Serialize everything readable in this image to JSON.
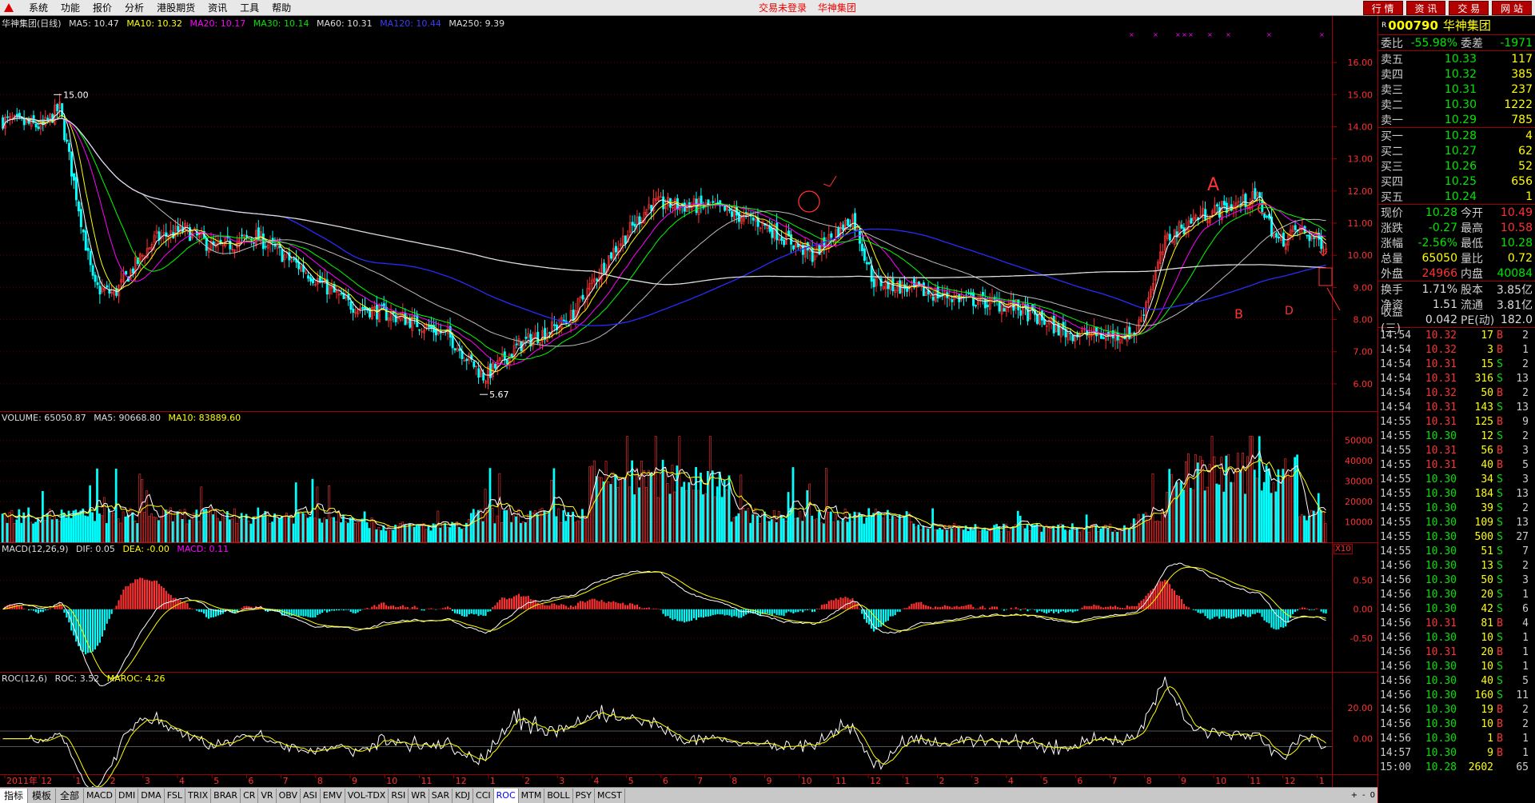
{
  "menubar": {
    "items": [
      "系统",
      "功能",
      "报价",
      "分析",
      "港股期货",
      "资讯",
      "工具",
      "帮助"
    ],
    "status_text": "交易未登录",
    "stock_title": "华神集团",
    "nav_buttons": [
      "行 情",
      "资 讯",
      "交 易",
      "网 站"
    ]
  },
  "main_chart": {
    "title": "华神集团(日线)",
    "ma5": "MA5: 10.47",
    "ma10": "MA10: 10.32",
    "ma20": "MA20: 10.17",
    "ma30": "MA30: 10.14",
    "ma60": "MA60: 10.31",
    "ma120": "MA120: 10.44",
    "ma250": "MA250: 9.39",
    "high_label": "15.00",
    "low_label": "5.67",
    "annotations": [
      "A",
      "C",
      "B",
      "D"
    ]
  },
  "volume_chart": {
    "volume": "VOLUME: 65050.87",
    "ma5": "MA5: 90668.80",
    "ma10": "MA10: 83889.60",
    "unit_badge": "X10"
  },
  "macd_chart": {
    "title": "MACD(12,26,9)",
    "dif": "DIF: 0.05",
    "dea": "DEA: -0.00",
    "macd": "MACD: 0.11"
  },
  "roc_chart": {
    "title": "ROC(12,6)",
    "roc": "ROC: 3.52",
    "maroc": "MAROC: 4.26"
  },
  "x_axis": {
    "labels": [
      "2011年",
      "12",
      "1",
      "2",
      "3",
      "4",
      "5",
      "6",
      "7",
      "8",
      "9",
      "10",
      "11",
      "12",
      "1",
      "2",
      "3",
      "4",
      "5",
      "6",
      "7",
      "8",
      "9",
      "10",
      "11",
      "12",
      "1",
      "2",
      "3",
      "4",
      "5",
      "6",
      "7",
      "8",
      "9",
      "10",
      "11",
      "12",
      "1"
    ],
    "period": "日线"
  },
  "price_axis": [
    "16.00",
    "15.00",
    "14.00",
    "13.00",
    "12.00",
    "11.00",
    "10.00",
    "9.00",
    "8.00",
    "7.00",
    "6.00"
  ],
  "volume_axis": [
    "50000",
    "40000",
    "30000",
    "20000",
    "10000"
  ],
  "macd_axis": [
    "0.50",
    "0.00",
    "-0.50"
  ],
  "roc_axis": [
    "20.00",
    "0.00"
  ],
  "quote": {
    "code": "000790",
    "name": "华神集团",
    "r_badge": "R",
    "weibi_label": "委比",
    "weibi": "-55.98%",
    "weicha_label": "委差",
    "weicha": "-1971",
    "sells": [
      {
        "label": "卖五",
        "price": "10.33",
        "vol": "117"
      },
      {
        "label": "卖四",
        "price": "10.32",
        "vol": "385"
      },
      {
        "label": "卖三",
        "price": "10.31",
        "vol": "237"
      },
      {
        "label": "卖二",
        "price": "10.30",
        "vol": "1222"
      },
      {
        "label": "卖一",
        "price": "10.29",
        "vol": "785"
      }
    ],
    "buys": [
      {
        "label": "买一",
        "price": "10.28",
        "vol": "4"
      },
      {
        "label": "买二",
        "price": "10.27",
        "vol": "62"
      },
      {
        "label": "买三",
        "price": "10.26",
        "vol": "52"
      },
      {
        "label": "买四",
        "price": "10.25",
        "vol": "656"
      },
      {
        "label": "买五",
        "price": "10.24",
        "vol": "1"
      }
    ],
    "stats": [
      {
        "l1": "现价",
        "v1": "10.28",
        "c1": "green",
        "l2": "今开",
        "v2": "10.49",
        "c2": "red"
      },
      {
        "l1": "涨跌",
        "v1": "-0.27",
        "c1": "green",
        "l2": "最高",
        "v2": "10.58",
        "c2": "red"
      },
      {
        "l1": "涨幅",
        "v1": "-2.56%",
        "c1": "green",
        "l2": "最低",
        "v2": "10.28",
        "c2": "green"
      },
      {
        "l1": "总量",
        "v1": "65050",
        "c1": "yellow",
        "l2": "量比",
        "v2": "0.72",
        "c2": "yellow"
      },
      {
        "l1": "外盘",
        "v1": "24966",
        "c1": "red",
        "l2": "内盘",
        "v2": "40084",
        "c2": "green"
      }
    ],
    "fundamentals": [
      {
        "l1": "换手",
        "v1": "1.71%",
        "l2": "股本",
        "v2": "3.85亿"
      },
      {
        "l1": "净资",
        "v1": "1.51",
        "l2": "流通",
        "v2": "3.81亿"
      },
      {
        "l1": "收益(三)",
        "v1": "0.042",
        "l2": "PE(动)",
        "v2": "182.0"
      }
    ],
    "ticks": [
      {
        "t": "14:54",
        "p": "10.32",
        "v": "17",
        "d": "B",
        "n": "2"
      },
      {
        "t": "14:54",
        "p": "10.32",
        "v": "3",
        "d": "B",
        "n": "1"
      },
      {
        "t": "14:54",
        "p": "10.31",
        "v": "15",
        "d": "S",
        "n": "2"
      },
      {
        "t": "14:54",
        "p": "10.31",
        "v": "316",
        "d": "S",
        "n": "13"
      },
      {
        "t": "14:54",
        "p": "10.32",
        "v": "50",
        "d": "B",
        "n": "2"
      },
      {
        "t": "14:54",
        "p": "10.31",
        "v": "143",
        "d": "S",
        "n": "13"
      },
      {
        "t": "14:55",
        "p": "10.31",
        "v": "125",
        "d": "B",
        "n": "9"
      },
      {
        "t": "14:55",
        "p": "10.30",
        "v": "12",
        "d": "S",
        "n": "2"
      },
      {
        "t": "14:55",
        "p": "10.31",
        "v": "56",
        "d": "B",
        "n": "3"
      },
      {
        "t": "14:55",
        "p": "10.31",
        "v": "40",
        "d": "B",
        "n": "5"
      },
      {
        "t": "14:55",
        "p": "10.30",
        "v": "34",
        "d": "S",
        "n": "3"
      },
      {
        "t": "14:55",
        "p": "10.30",
        "v": "184",
        "d": "S",
        "n": "13"
      },
      {
        "t": "14:55",
        "p": "10.30",
        "v": "39",
        "d": "S",
        "n": "2"
      },
      {
        "t": "14:55",
        "p": "10.30",
        "v": "109",
        "d": "S",
        "n": "13"
      },
      {
        "t": "14:55",
        "p": "10.30",
        "v": "500",
        "d": "S",
        "n": "27"
      },
      {
        "t": "14:55",
        "p": "10.30",
        "v": "51",
        "d": "S",
        "n": "7"
      },
      {
        "t": "14:56",
        "p": "10.30",
        "v": "13",
        "d": "S",
        "n": "2"
      },
      {
        "t": "14:56",
        "p": "10.30",
        "v": "50",
        "d": "S",
        "n": "3"
      },
      {
        "t": "14:56",
        "p": "10.30",
        "v": "20",
        "d": "S",
        "n": "1"
      },
      {
        "t": "14:56",
        "p": "10.30",
        "v": "42",
        "d": "S",
        "n": "6"
      },
      {
        "t": "14:56",
        "p": "10.31",
        "v": "81",
        "d": "B",
        "n": "4"
      },
      {
        "t": "14:56",
        "p": "10.30",
        "v": "10",
        "d": "S",
        "n": "1"
      },
      {
        "t": "14:56",
        "p": "10.31",
        "v": "20",
        "d": "B",
        "n": "1"
      },
      {
        "t": "14:56",
        "p": "10.30",
        "v": "10",
        "d": "S",
        "n": "1"
      },
      {
        "t": "14:56",
        "p": "10.30",
        "v": "40",
        "d": "S",
        "n": "5"
      },
      {
        "t": "14:56",
        "p": "10.30",
        "v": "160",
        "d": "S",
        "n": "11"
      },
      {
        "t": "14:56",
        "p": "10.30",
        "v": "19",
        "d": "B",
        "n": "2"
      },
      {
        "t": "14:56",
        "p": "10.30",
        "v": "10",
        "d": "B",
        "n": "2"
      },
      {
        "t": "14:56",
        "p": "10.30",
        "v": "1",
        "d": "B",
        "n": "1"
      },
      {
        "t": "14:57",
        "p": "10.30",
        "v": "9",
        "d": "B",
        "n": "1"
      },
      {
        "t": "15:00",
        "p": "10.28",
        "v": "2602",
        "d": "",
        "n": "65"
      }
    ]
  },
  "tabbar": {
    "big_tabs": [
      "指标",
      "模板",
      "全部"
    ],
    "indicator_tabs": [
      "MACD",
      "DMI",
      "DMA",
      "FSL",
      "TRIX",
      "BRAR",
      "CR",
      "VR",
      "OBV",
      "ASI",
      "EMV",
      "VOL-TDX",
      "RSI",
      "WR",
      "SAR",
      "KDJ",
      "CCI",
      "ROC",
      "MTM",
      "BOLL",
      "PSY",
      "MCST"
    ],
    "right_arrows": [
      "+",
      "-",
      "0"
    ]
  }
}
